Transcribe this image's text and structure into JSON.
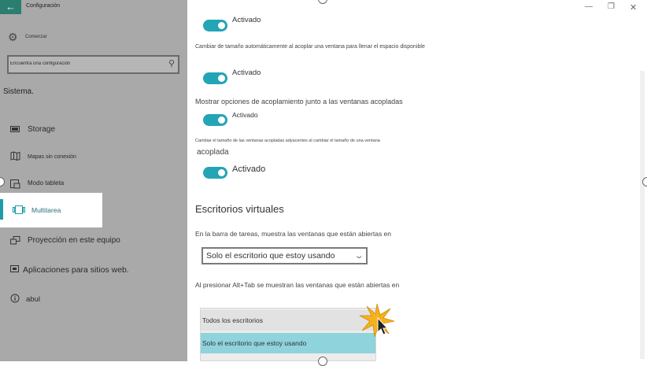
{
  "window": {
    "title": "Configuración",
    "minimize_icon": "minimize-icon",
    "maximize_icon": "maximize-icon",
    "close_icon": "close-icon"
  },
  "sidebar": {
    "back_icon": "back-arrow-icon",
    "home": {
      "icon": "gear-icon",
      "label": "Comenzar"
    },
    "search": {
      "placeholder": "Encuentra una configuración",
      "icon": "search-icon"
    },
    "section_heading": "Sistema.",
    "items": [
      {
        "icon": "battery-icon",
        "label": "Storage"
      },
      {
        "icon": "map-icon",
        "label": "Mapas sin conexión"
      },
      {
        "icon": "tablet-mode-icon",
        "label": "Modo tableta"
      },
      {
        "icon": "multitasking-icon",
        "label": "Multitarea",
        "selected": true
      },
      {
        "icon": "projection-icon",
        "label": "Proyección en este equipo"
      },
      {
        "icon": "apps-websites-icon",
        "label": "Aplicaciones para sitios web."
      },
      {
        "icon": "info-icon",
        "label": "abul"
      }
    ]
  },
  "content": {
    "toggles": [
      {
        "state": "Activado"
      },
      {
        "description": "Cambiar de tamaño automáticamente al acoplar una ventana para llenar el espacio disponible",
        "state": "Activado"
      },
      {
        "description": "Mostrar opciones de acoplamiento junto a las ventanas acopladas",
        "state": "Activado"
      },
      {
        "description": "Cambiar el tamaño de las ventanas acopladas adyacentes al cambiar el tamaño de una ventana",
        "description_tail": "acoplada",
        "state": "Activado"
      }
    ],
    "virtual_desktops": {
      "heading": "Escritorios virtuales",
      "taskbar_label": "En la barra de tareas, muestra las ventanas que están abiertas en",
      "taskbar_value": "Solo el escritorio que estoy usando",
      "alttab_label": "Al presionar Alt+Tab se muestran las ventanas que están abiertas en",
      "alttab_options": [
        "Todos los escritorios",
        "Solo el escritorio que estoy usando"
      ],
      "alttab_highlighted": "Solo el escritorio que estoy usando"
    }
  },
  "colors": {
    "accent": "#23a5b5",
    "sidebar_bg": "#a9a9a9",
    "back_button": "#2b7d6f",
    "highlight_option": "#8fd3dc"
  }
}
